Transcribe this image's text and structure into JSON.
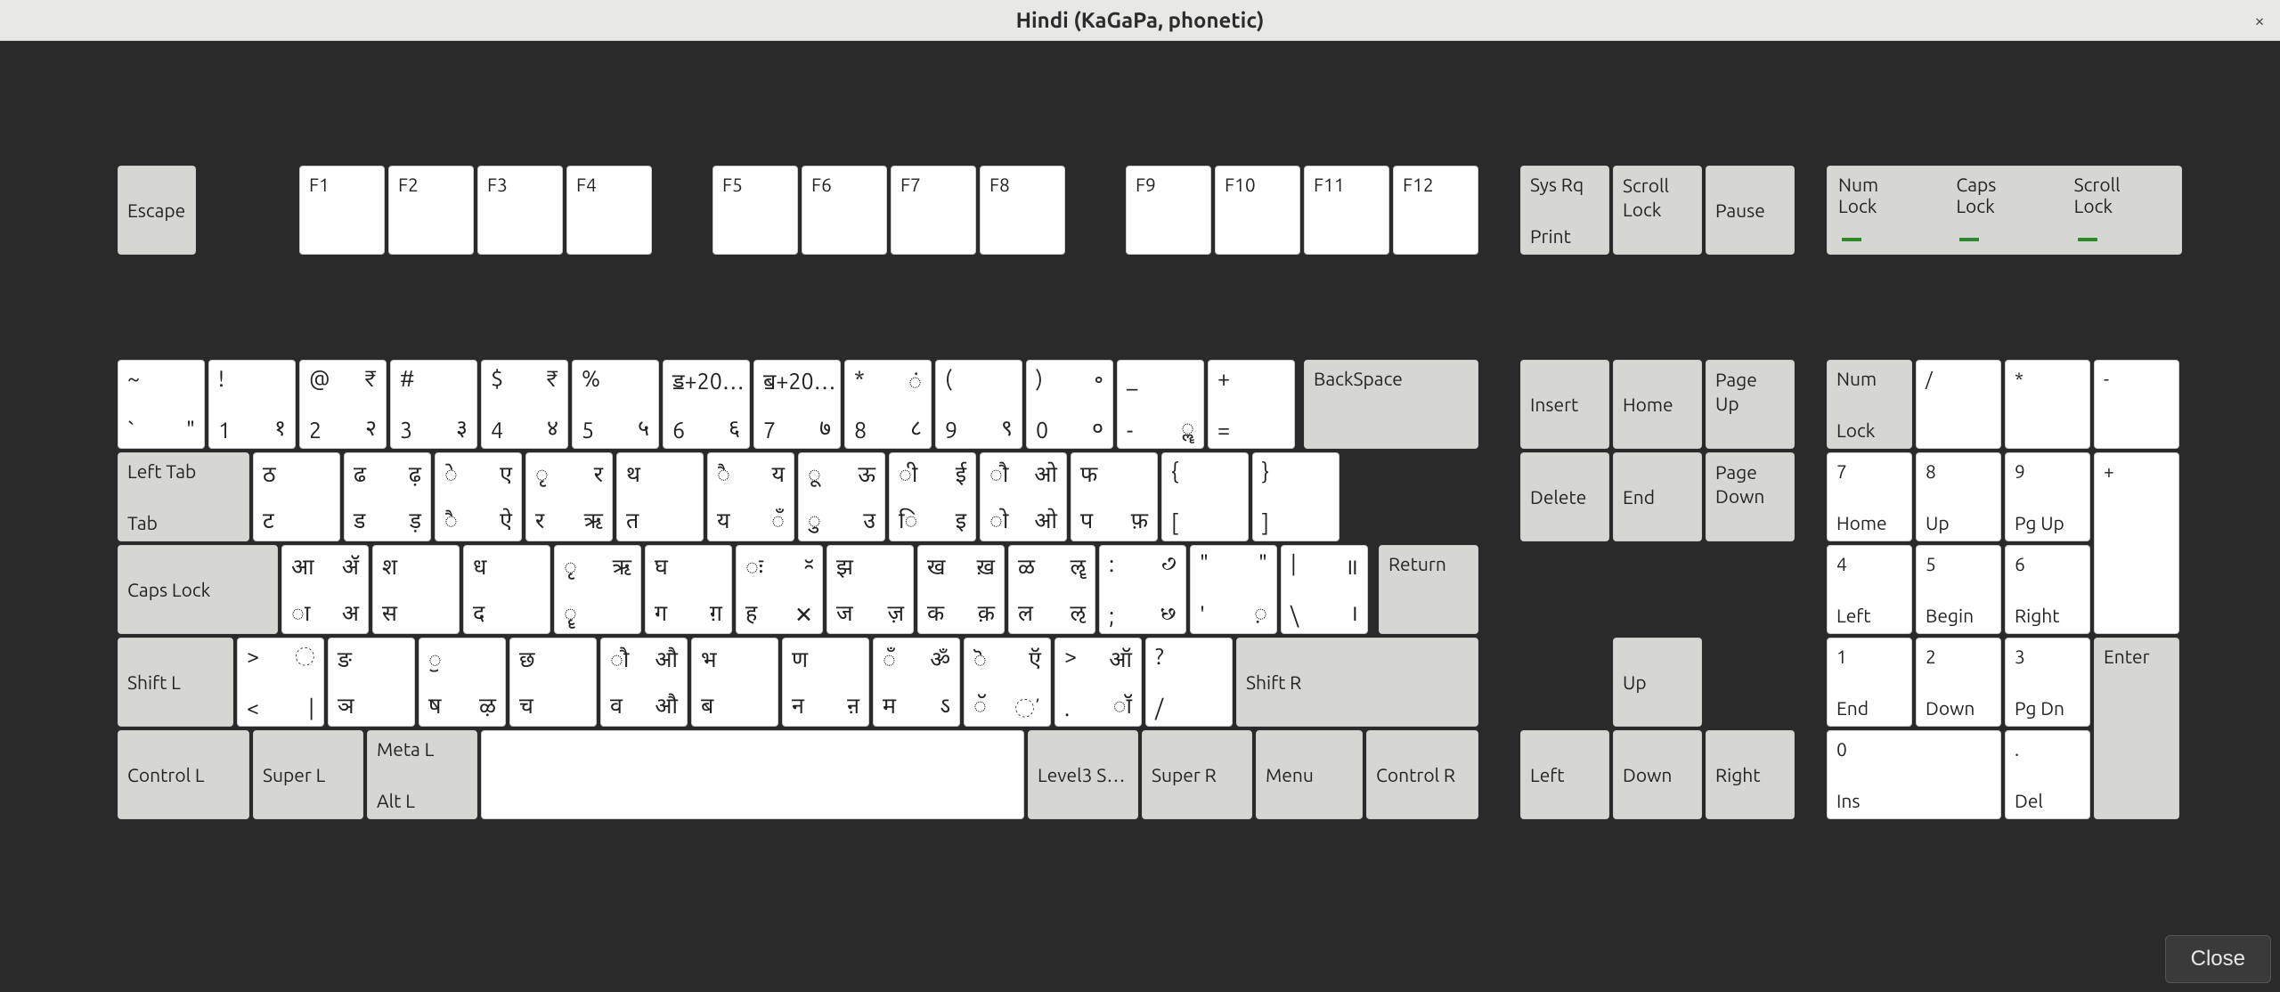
{
  "window": {
    "title": "Hindi (KaGaPa, phonetic)",
    "close_button": "Close"
  },
  "titlebar_close_glyph": "×",
  "close_icon_name": "close-icon",
  "locks": {
    "num": "Num\nLock",
    "caps": "Caps\nLock",
    "scroll": "Scroll\nLock"
  },
  "func": {
    "escape": "Escape",
    "f1": "F1",
    "f2": "F2",
    "f3": "F3",
    "f4": "F4",
    "f5": "F5",
    "f6": "F6",
    "f7": "F7",
    "f8": "F8",
    "f9": "F9",
    "f10": "F10",
    "f11": "F11",
    "f12": "F12",
    "sysrq_top": "Sys Rq",
    "sysrq_bot": "Print",
    "scroll_lock": "Scroll\nLock",
    "pause": "Pause"
  },
  "row1": [
    {
      "tl": "~",
      "tr": "",
      "bl": "`",
      "br": "\""
    },
    {
      "tl": "!",
      "tr": "",
      "bl": "1",
      "br": "१"
    },
    {
      "tl": "@",
      "tr": "₹",
      "bl": "2",
      "br": "२"
    },
    {
      "tl": "#",
      "tr": "",
      "bl": "3",
      "br": "३"
    },
    {
      "tl": "$",
      "tr": "₹",
      "bl": "4",
      "br": "४"
    },
    {
      "tl": "%",
      "tr": "",
      "bl": "5",
      "br": "५"
    },
    {
      "tl": "ॾ+20…",
      "tr": "",
      "bl": "6",
      "br": "६"
    },
    {
      "tl": "ॿ+20…",
      "tr": "",
      "bl": "7",
      "br": "७"
    },
    {
      "tl": "*",
      "tr": "◌ं",
      "bl": "8",
      "br": "८"
    },
    {
      "tl": "(",
      "tr": "",
      "bl": "9",
      "br": "९"
    },
    {
      "tl": ")",
      "tr": "॰",
      "bl": "0",
      "br": "०"
    },
    {
      "tl": "_",
      "tr": "",
      "bl": "-",
      "br": "◌ॣ"
    },
    {
      "tl": "+",
      "tr": "",
      "bl": "=",
      "br": ""
    }
  ],
  "backspace": "BackSpace",
  "nav1": {
    "insert": "Insert",
    "home": "Home",
    "pgup": "Page\nUp"
  },
  "np1": [
    {
      "t": "Num",
      "b": "Lock"
    },
    {
      "t": "/",
      "b": ""
    },
    {
      "t": "*",
      "b": ""
    },
    {
      "t": "-",
      "b": ""
    }
  ],
  "tab": {
    "top": "Left Tab",
    "bot": "Tab"
  },
  "row2": [
    {
      "tl": "ठ",
      "tr": "",
      "bl": "ट",
      "br": ""
    },
    {
      "tl": "ढ",
      "tr": "ढ़",
      "bl": "ड",
      "br": "ड़"
    },
    {
      "tl": "◌े",
      "tr": "ए",
      "bl": "◌ै",
      "br": "ऐ"
    },
    {
      "tl": "◌ृ",
      "tr": "र",
      "bl": "र",
      "br": "ऋ"
    },
    {
      "tl": "थ",
      "tr": "",
      "bl": "त",
      "br": ""
    },
    {
      "tl": "◌ै",
      "tr": "य",
      "bl": "य",
      "br": "◌ँ"
    },
    {
      "tl": "◌ू",
      "tr": "ऊ",
      "bl": "◌ु",
      "br": "उ"
    },
    {
      "tl": "◌ी",
      "tr": "ई",
      "bl": "◌ि",
      "br": "इ"
    },
    {
      "tl": "◌ौ",
      "tr": "ओ",
      "bl": "◌ो",
      "br": "ओ"
    },
    {
      "tl": "फ",
      "tr": "",
      "bl": "प",
      "br": "फ़"
    },
    {
      "tl": "{",
      "tr": "",
      "bl": "[",
      "br": ""
    },
    {
      "tl": "}",
      "tr": "",
      "bl": "]",
      "br": ""
    }
  ],
  "nav2": {
    "delete": "Delete",
    "end": "End",
    "pgdn": "Page\nDown"
  },
  "np2": [
    {
      "t": "7",
      "b": "Home"
    },
    {
      "t": "8",
      "b": "Up"
    },
    {
      "t": "9",
      "b": "Pg Up"
    },
    {
      "t": "+",
      "b": ""
    }
  ],
  "caps": "Caps Lock",
  "row3": [
    {
      "tl": "आ",
      "tr": "ॲ",
      "bl": "◌ा",
      "br": "अ"
    },
    {
      "tl": "श",
      "tr": "",
      "bl": "स",
      "br": ""
    },
    {
      "tl": "ध",
      "tr": "",
      "bl": "द",
      "br": ""
    },
    {
      "tl": "◌ृ",
      "tr": "ऋ",
      "bl": "◌ॄ",
      "br": ""
    },
    {
      "tl": "घ",
      "tr": "",
      "bl": "ग",
      "br": "ग़"
    },
    {
      "tl": "◌ः",
      "tr": "ᳲ",
      "bl": "ह",
      "br": "✕"
    },
    {
      "tl": "झ",
      "tr": "",
      "bl": "ज",
      "br": "ज़"
    },
    {
      "tl": "ख",
      "tr": "ख़",
      "bl": "क",
      "br": "क़"
    },
    {
      "tl": "ळ",
      "tr": "ॡ",
      "bl": "ल",
      "br": "ऌ"
    },
    {
      "tl": ":",
      "tr": "꣹",
      "bl": ";",
      "br": "꣸"
    },
    {
      "tl": "\"",
      "tr": "\"",
      "bl": "'",
      "br": "◌़"
    },
    {
      "tl": "|",
      "tr": "॥",
      "bl": "\\",
      "br": "।"
    }
  ],
  "return": "Return",
  "np3": [
    {
      "t": "4",
      "b": "Left"
    },
    {
      "t": "5",
      "b": "Begin"
    },
    {
      "t": "6",
      "b": "Right"
    }
  ],
  "shiftl": "Shift L",
  "ltgt": {
    "tl": ">",
    "tr": "◌",
    "bl": "<",
    "br": "|"
  },
  "row4": [
    {
      "tl": "ङ",
      "tr": "",
      "bl": "ञ",
      "br": ""
    },
    {
      "tl": "◌ॖ",
      "tr": "",
      "bl": "ष",
      "br": "ऴ"
    },
    {
      "tl": "छ",
      "tr": "",
      "bl": "च",
      "br": ""
    },
    {
      "tl": "◌ौ",
      "tr": "औ",
      "bl": "व",
      "br": "औ"
    },
    {
      "tl": "भ",
      "tr": "",
      "bl": "ब",
      "br": ""
    },
    {
      "tl": "ण",
      "tr": "",
      "bl": "न",
      "br": "ऩ"
    },
    {
      "tl": "◌ँ",
      "tr": "ॐ",
      "bl": "म",
      "br": "ऽ"
    },
    {
      "tl": "◌ॆ",
      "tr": "ऍ",
      "bl": "◌ॅ",
      "br": "◌ʼ"
    },
    {
      "tl": ">",
      "tr": "ऑ",
      "bl": ".",
      "br": "◌ॉ"
    },
    {
      "tl": "?",
      "tr": "",
      "bl": "/",
      "br": ""
    }
  ],
  "shiftr": "Shift R",
  "nav4": {
    "up": "Up"
  },
  "np4": [
    {
      "t": "1",
      "b": "End"
    },
    {
      "t": "2",
      "b": "Down"
    },
    {
      "t": "3",
      "b": "Pg Dn"
    }
  ],
  "ctrl_l": "Control L",
  "super_l": "Super L",
  "meta_l_top": "Meta L",
  "alt_l": "Alt L",
  "level3": "Level3 S…",
  "super_r": "Super R",
  "menu": "Menu",
  "ctrl_r": "Control R",
  "nav5": {
    "left": "Left",
    "down": "Down",
    "right": "Right"
  },
  "np5": [
    {
      "t": "0",
      "b": "Ins"
    },
    {
      "t": ".",
      "b": "Del"
    },
    {
      "t": "Enter",
      "b": ""
    }
  ]
}
